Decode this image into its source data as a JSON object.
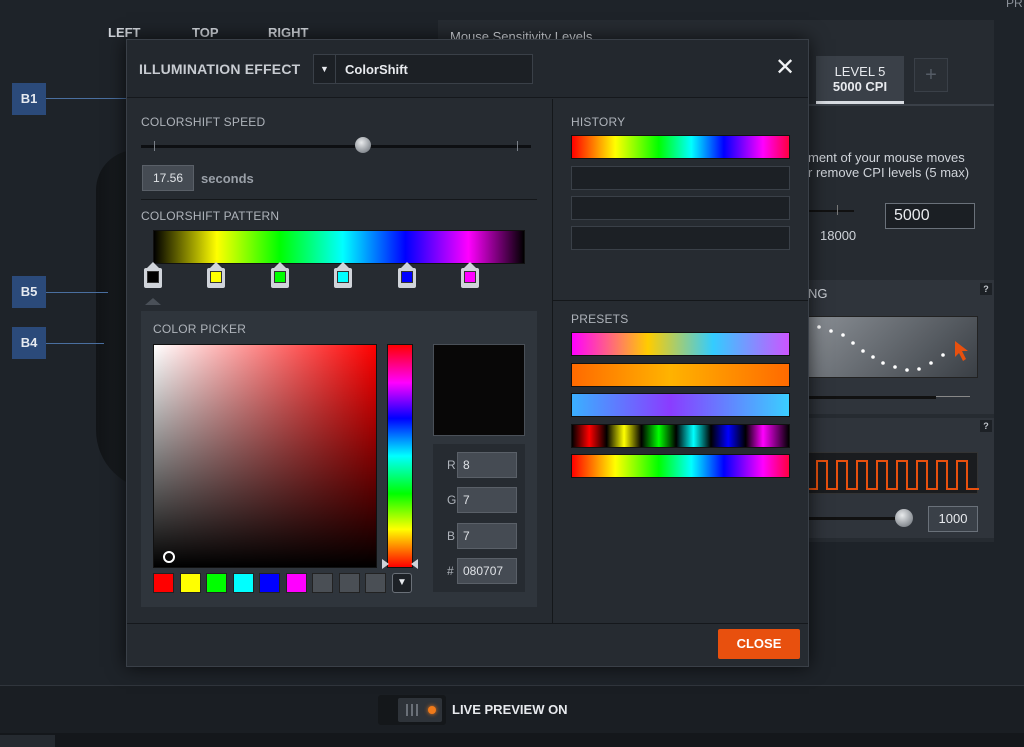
{
  "background": {
    "tabs": [
      "LEFT",
      "TOP",
      "RIGHT"
    ],
    "corner_text": "PR",
    "button_labels": [
      "B1",
      "B5",
      "B4"
    ],
    "sensitivity_title": "Mouse Sensitivity Levels",
    "level": {
      "name": "LEVEL 5",
      "cpi": "5000 CPI"
    },
    "add_symbol": "+",
    "desc_line1": "ment of your mouse moves",
    "desc_line2": "r remove CPI levels (5 max)",
    "max_cpi": "18000",
    "cpi_value": "5000",
    "accel_fragment": "NG",
    "help_symbol": "?",
    "polling_value": "1000",
    "live_preview": "LIVE PREVIEW ON"
  },
  "dialog": {
    "title": "ILLUMINATION EFFECT",
    "effect": "ColorShift",
    "close_x": "✕",
    "speed_label": "COLORSHIFT SPEED",
    "speed_value": "17.56",
    "speed_unit": "seconds",
    "speed_fraction": 0.57,
    "pattern_label": "COLORSHIFT PATTERN",
    "pattern_stops": [
      {
        "color": "#000000"
      },
      {
        "color": "#ffff00"
      },
      {
        "color": "#00ff00"
      },
      {
        "color": "#00ffff"
      },
      {
        "color": "#0000ff"
      },
      {
        "color": "#ff00ff"
      }
    ],
    "picker_label": "COLOR PICKER",
    "rgb": {
      "r_label": "R",
      "r": "8",
      "g_label": "G",
      "g": "7",
      "b_label": "B",
      "b": "7",
      "hex_label": "#",
      "hex": "080707"
    },
    "quick_swatches": [
      "#ff0000",
      "#ffff00",
      "#00ff00",
      "#00ffff",
      "#0000ff",
      "#ff00ff",
      "#4a4f55",
      "#4a4f55",
      "#4a4f55"
    ],
    "more_symbol": "▼",
    "history_label": "HISTORY",
    "presets_label": "PRESETS",
    "close_button": "CLOSE"
  },
  "colors": {
    "accent": "#e8500e",
    "live_dot": "#f07a1a"
  }
}
